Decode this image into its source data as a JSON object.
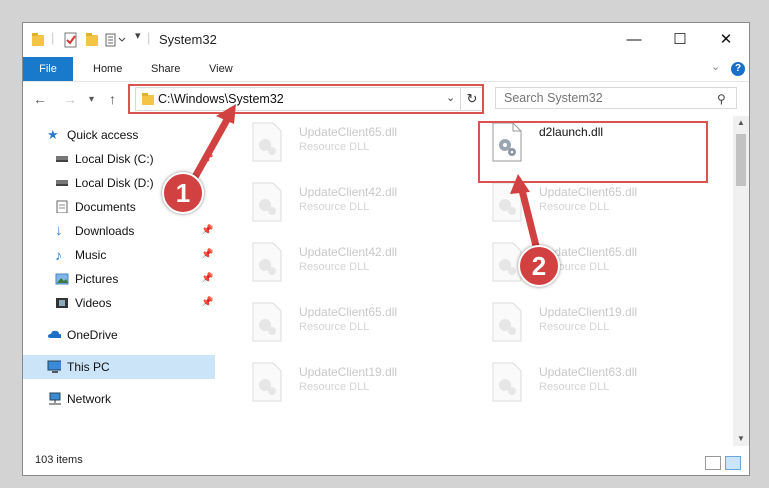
{
  "window": {
    "title": "System32",
    "minimize": "—",
    "maximize": "☐",
    "close": "✕"
  },
  "ribbon": {
    "tabs": [
      "File",
      "Home",
      "Share",
      "View"
    ],
    "help": "?"
  },
  "navbar": {
    "address": "C:\\Windows\\System32",
    "search_placeholder": "Search System32"
  },
  "sidebar": {
    "items": [
      {
        "label": "Quick access",
        "icon": "star-icon"
      },
      {
        "label": "Local Disk (C:)",
        "icon": "drive-icon"
      },
      {
        "label": "Local Disk (D:)",
        "icon": "drive-icon"
      },
      {
        "label": "Documents",
        "icon": "documents-icon"
      },
      {
        "label": "Downloads",
        "icon": "download-icon"
      },
      {
        "label": "Music",
        "icon": "music-icon"
      },
      {
        "label": "Pictures",
        "icon": "pictures-icon"
      },
      {
        "label": "Videos",
        "icon": "videos-icon"
      },
      {
        "label": "OneDrive",
        "icon": "cloud-icon"
      },
      {
        "label": "This PC",
        "icon": "computer-icon"
      },
      {
        "label": "Network",
        "icon": "network-icon"
      }
    ]
  },
  "files": [
    {
      "name": "UpdateClient65.dll",
      "type": "Resource DLL"
    },
    {
      "name": "d2launch.dll",
      "type": ""
    },
    {
      "name": "UpdateClient42.dll",
      "type": "Resource DLL"
    },
    {
      "name": "UpdateClient65.dll",
      "type": "Resource DLL"
    },
    {
      "name": "UpdateClient42.dll",
      "type": "Resource DLL"
    },
    {
      "name": "UpdateClient65.dll",
      "type": "Resource DLL"
    },
    {
      "name": "UpdateClient65.dll",
      "type": "Resource DLL"
    },
    {
      "name": "UpdateClient19.dll",
      "type": "Resource DLL"
    },
    {
      "name": "UpdateClient19.dll",
      "type": "Resource DLL"
    },
    {
      "name": "UpdateClient63.dll",
      "type": "Resource DLL"
    }
  ],
  "status": {
    "items_count": "103 items"
  },
  "annotations": {
    "badge1": "1",
    "badge2": "2",
    "highlight_color": "#d9534f"
  }
}
